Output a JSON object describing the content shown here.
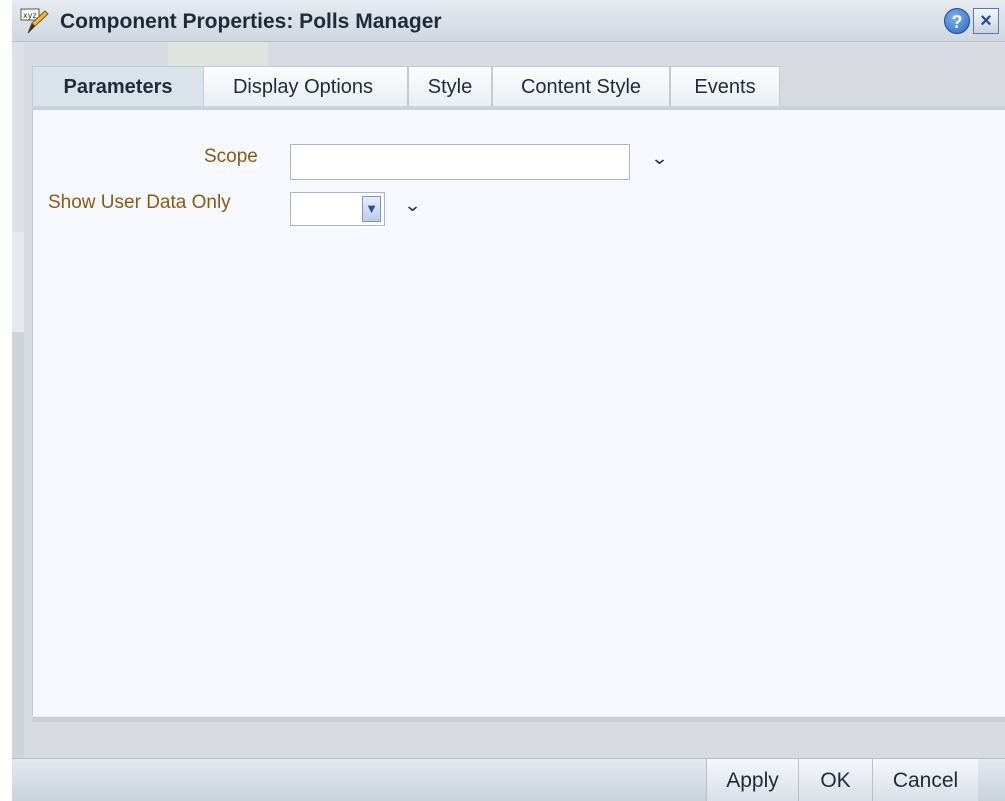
{
  "window": {
    "title": "Component Properties: Polls Manager",
    "help_label": "?",
    "close_label": "×"
  },
  "tabs": [
    {
      "label": "Parameters",
      "active": true
    },
    {
      "label": "Display Options",
      "active": false
    },
    {
      "label": "Style",
      "active": false
    },
    {
      "label": "Content Style",
      "active": false
    },
    {
      "label": "Events",
      "active": false
    }
  ],
  "form": {
    "scope": {
      "label": "Scope",
      "value": ""
    },
    "show_user_data_only": {
      "label": "Show User Data Only",
      "value": ""
    },
    "expand_glyph": "⌄",
    "dropdown_glyph": "▼"
  },
  "buttons": {
    "apply": "Apply",
    "ok": "OK",
    "cancel": "Cancel"
  },
  "colors": {
    "label": "#8a5a12",
    "content_bg": "#f7f8fd",
    "accent_blue": "#2b64c4"
  }
}
